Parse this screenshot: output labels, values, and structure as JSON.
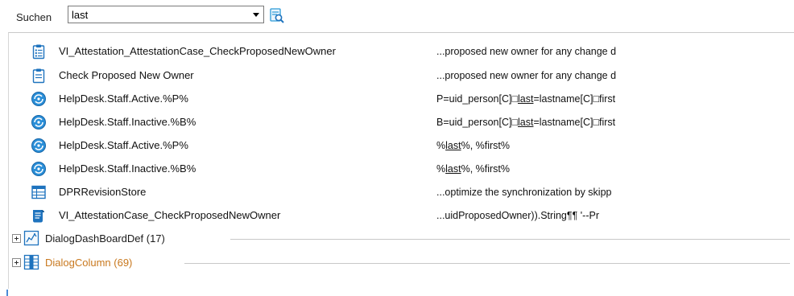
{
  "search": {
    "label": "Suchen",
    "value": "last"
  },
  "results": [
    {
      "name": "VI_Attestation_AttestationCase_CheckProposedNewOwner",
      "icon": "clipboard-list-icon",
      "snippet_parts": [
        "...proposed new owner for any change d"
      ]
    },
    {
      "name": "Check Proposed New Owner",
      "icon": "clipboard-icon",
      "snippet_parts": [
        "...proposed new owner for any change d"
      ]
    },
    {
      "name": "HelpDesk.Staff.Active.%P%",
      "icon": "globe-script-icon",
      "snippet_parts": [
        "P=uid_person[C]□",
        "last",
        "=lastname[C]□first"
      ]
    },
    {
      "name": "HelpDesk.Staff.Inactive.%B%",
      "icon": "globe-script-icon",
      "snippet_parts": [
        "B=uid_person[C]□",
        "last",
        "=lastname[C]□first"
      ]
    },
    {
      "name": "HelpDesk.Staff.Active.%P%",
      "icon": "globe-script-icon",
      "snippet_parts": [
        "%",
        "last",
        "%, %first%"
      ]
    },
    {
      "name": "HelpDesk.Staff.Inactive.%B%",
      "icon": "globe-script-icon",
      "snippet_parts": [
        "%",
        "last",
        "%, %first%"
      ]
    },
    {
      "name": "DPRRevisionStore",
      "icon": "table-icon",
      "snippet_parts": [
        "...optimize the synchronization by skipp"
      ]
    },
    {
      "name": "VI_AttestationCase_CheckProposedNewOwner",
      "icon": "script-scroll-icon",
      "snippet_parts": [
        "...uidProposedOwner)).String¶¶       '--Pr"
      ]
    }
  ],
  "groups": [
    {
      "label": "DialogDashBoardDef (17)",
      "icon": "dashboard-chart-icon",
      "color": "#1a1a1a"
    },
    {
      "label": "DialogColumn (69)",
      "icon": "table-columns-icon",
      "color": "#c8781e"
    }
  ],
  "colors": {
    "accent": "#1e73be",
    "search_icon_accent": "#2b9ad8",
    "group_highlight": "#c8781e"
  }
}
